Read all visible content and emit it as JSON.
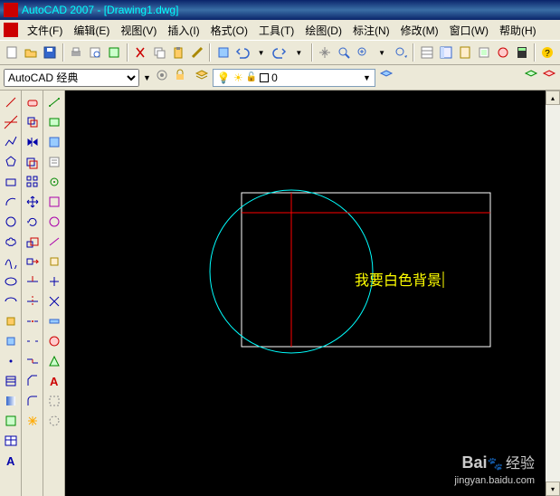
{
  "title": "AutoCAD 2007 - [Drawing1.dwg]",
  "menus": [
    "文件(F)",
    "编辑(E)",
    "视图(V)",
    "插入(I)",
    "格式(O)",
    "工具(T)",
    "绘图(D)",
    "标注(N)",
    "修改(M)",
    "窗口(W)",
    "帮助(H)"
  ],
  "workspace": {
    "selected": "AutoCAD 经典"
  },
  "layer": {
    "name": "0",
    "color": "#ffffff"
  },
  "canvas": {
    "text": "我要白色背景",
    "text_color": "#ffff00"
  },
  "watermark": {
    "brand_a": "Bai",
    "brand_b": "经验",
    "url": "jingyan.baidu.com"
  },
  "icons": {
    "new": "new",
    "open": "open",
    "save": "save",
    "print": "print",
    "cut": "cut",
    "copy": "copy",
    "paste": "paste",
    "match": "match",
    "undo": "undo",
    "redo": "redo"
  },
  "draw_tools": [
    "line",
    "xline",
    "pline",
    "polygon",
    "rectangle",
    "arc",
    "circle",
    "revcloud",
    "spline",
    "ellipse",
    "ellipse-arc",
    "block",
    "point",
    "hatch",
    "gradient",
    "region",
    "table",
    "mtext"
  ],
  "modify_tools": [
    "erase",
    "copy",
    "mirror",
    "offset",
    "array",
    "move",
    "rotate",
    "scale",
    "stretch",
    "trim",
    "extend",
    "break",
    "join",
    "chamfer",
    "fillet",
    "explode"
  ]
}
